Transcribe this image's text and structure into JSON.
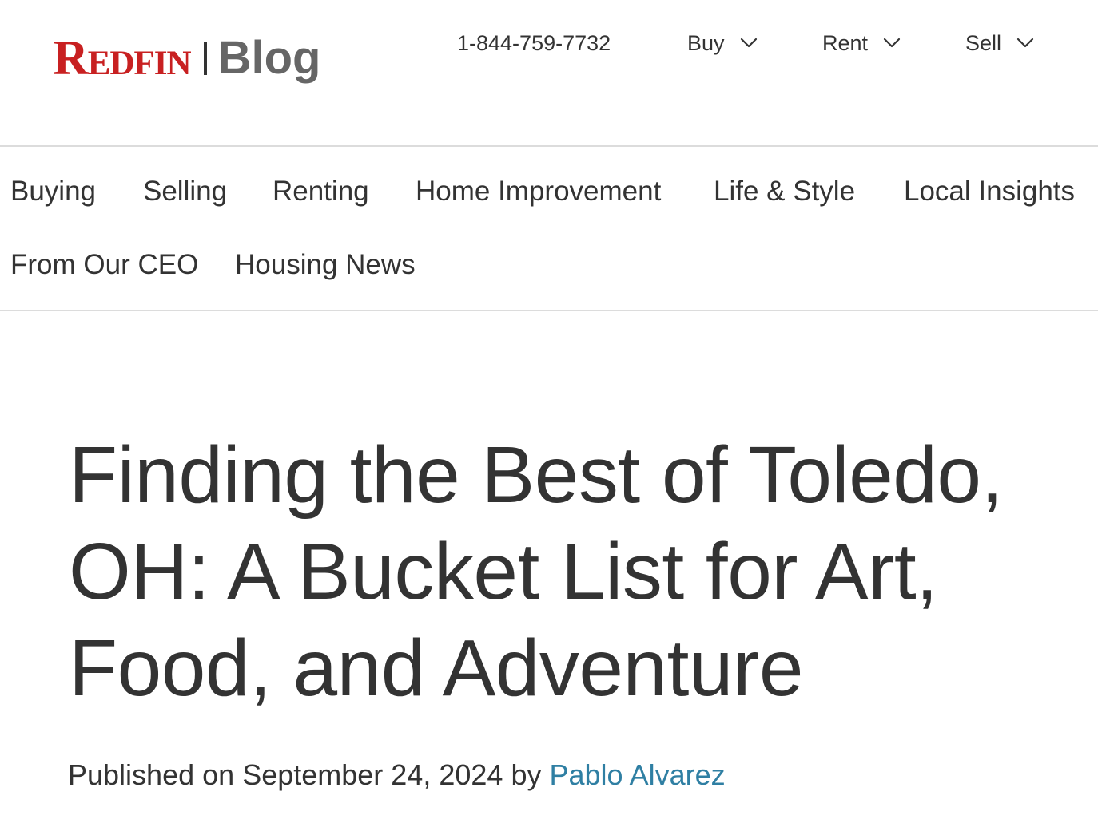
{
  "brand": {
    "name": "Redfin",
    "logo_text": "REDFIN",
    "section": "Blog",
    "color": "#c82021"
  },
  "top_nav": {
    "phone": "1-844-759-7732",
    "menus": [
      {
        "label": "Buy",
        "icon": "chevron-down-icon"
      },
      {
        "label": "Rent",
        "icon": "chevron-down-icon"
      },
      {
        "label": "Sell",
        "icon": "chevron-down-icon"
      }
    ]
  },
  "categories": [
    {
      "label": "Buying"
    },
    {
      "label": "Selling"
    },
    {
      "label": "Renting"
    },
    {
      "label": "Home Improvement"
    },
    {
      "label": "Life & Style"
    },
    {
      "label": "Local Insights"
    },
    {
      "label": "From Our CEO"
    },
    {
      "label": "Housing News"
    }
  ],
  "article": {
    "title": "Finding the Best of Toledo, OH: A Bucket List for Art, Food, and Adventure",
    "published_prefix": "Published on",
    "published_date": "September 24, 2024",
    "by": "by",
    "author": "Pablo Alvarez",
    "author_link_color": "#2f7fa3"
  }
}
